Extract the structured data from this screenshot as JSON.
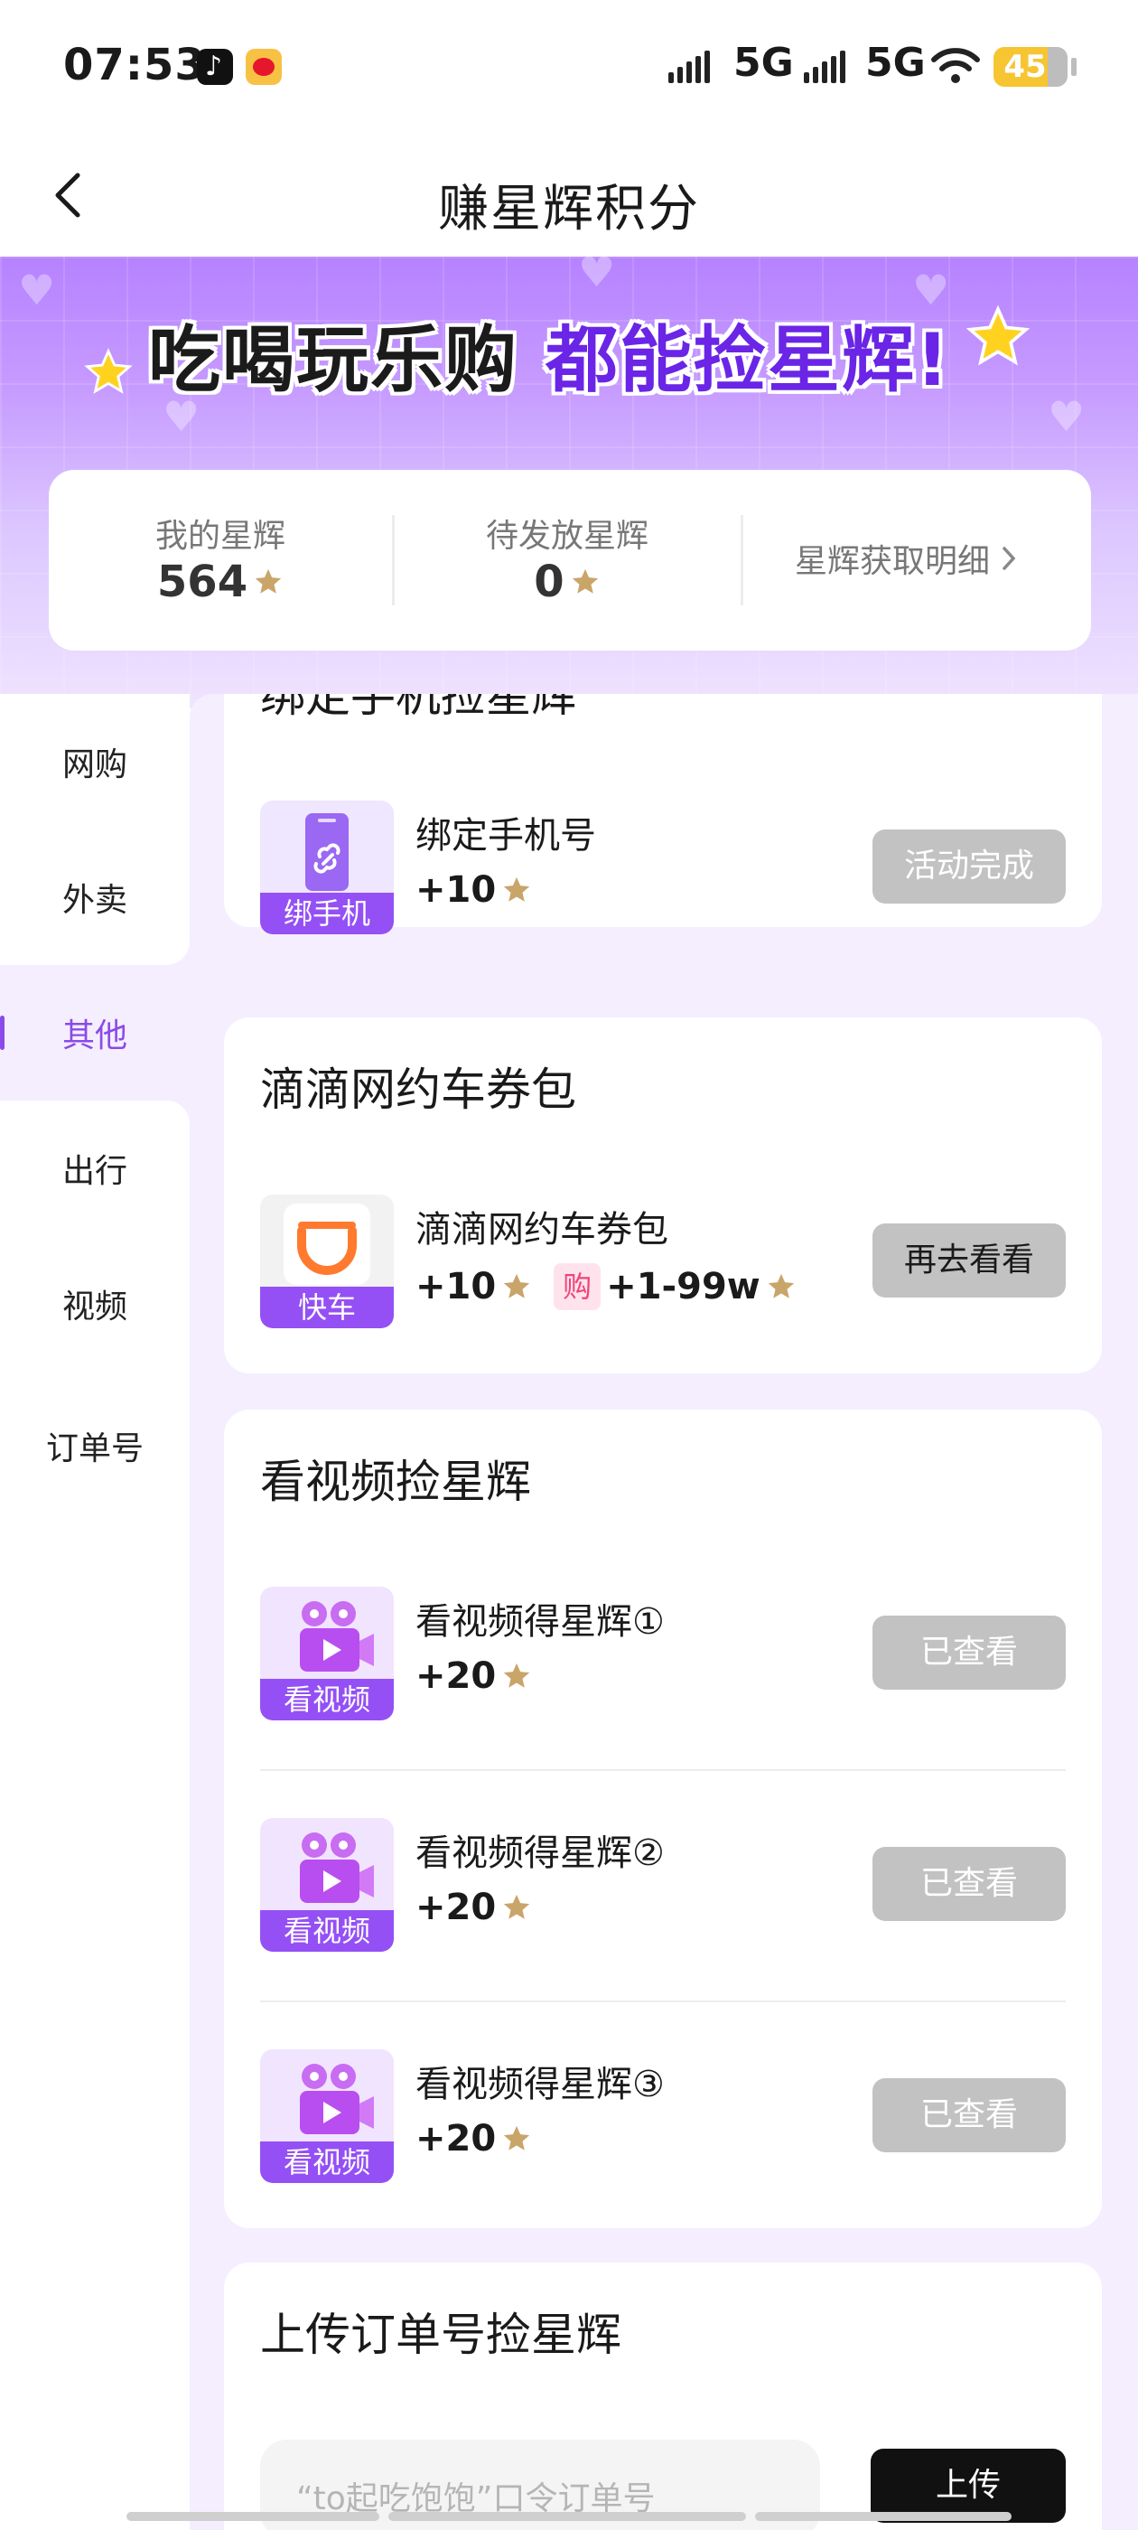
{
  "status_bar": {
    "time": "07:53",
    "network_1": "5G",
    "network_2": "5G",
    "battery": "45",
    "apps": [
      "tiktok-icon",
      "weibo-icon"
    ]
  },
  "header": {
    "title": "赚星辉积分",
    "back_icon": "chevron-left-icon"
  },
  "banner": {
    "slogan_part1": "吃喝玩乐购",
    "slogan_part2": "都能捡星辉!"
  },
  "points": {
    "my_label": "我的星辉",
    "my_value": "564",
    "pending_label": "待发放星辉",
    "pending_value": "0",
    "detail_link": "星辉获取明细"
  },
  "sidebar": {
    "items": [
      {
        "label": "网购"
      },
      {
        "label": "外卖"
      },
      {
        "label": "其他",
        "active": true
      },
      {
        "label": "出行"
      },
      {
        "label": "视频"
      },
      {
        "label": "订单号"
      }
    ]
  },
  "sections": {
    "bind_phone": {
      "title": "绑定手机捡星辉",
      "task": {
        "name": "绑定手机号",
        "reward": "+10",
        "icon_tag": "绑手机",
        "button": "活动完成"
      }
    },
    "didi": {
      "title": "滴滴网约车券包",
      "task": {
        "name": "滴滴网约车券包",
        "reward": "+10",
        "buy_chip": "购",
        "extra_reward": "+1-99w",
        "icon_tag": "快车",
        "button": "再去看看"
      }
    },
    "video": {
      "title": "看视频捡星辉",
      "tasks": [
        {
          "name": "看视频得星辉①",
          "reward": "+20",
          "icon_tag": "看视频",
          "button": "已查看"
        },
        {
          "name": "看视频得星辉②",
          "reward": "+20",
          "icon_tag": "看视频",
          "button": "已查看"
        },
        {
          "name": "看视频得星辉③",
          "reward": "+20",
          "icon_tag": "看视频",
          "button": "已查看"
        }
      ]
    },
    "order": {
      "title": "上传订单号捡星辉",
      "input_placeholder": "“to起吃饱饱”口令订单号",
      "button": "上传"
    }
  },
  "colors": {
    "accent": "#8a4be8",
    "star": "#c9a56a",
    "button_disabled": "#c2c2c2",
    "banner_top": "#b682ff"
  }
}
